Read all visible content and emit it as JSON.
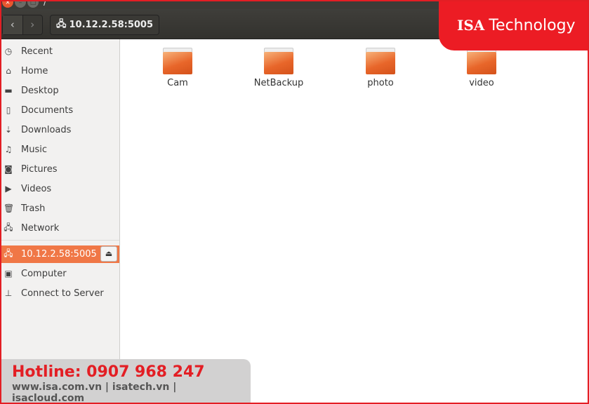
{
  "window": {
    "title": "/"
  },
  "toolbar": {
    "back": "‹",
    "forward": "›",
    "location": "10.12.2.58:5005"
  },
  "sidebar": {
    "items": [
      {
        "label": "Recent",
        "icon": "clock-icon"
      },
      {
        "label": "Home",
        "icon": "home-icon"
      },
      {
        "label": "Desktop",
        "icon": "desktop-folder-icon"
      },
      {
        "label": "Documents",
        "icon": "document-icon"
      },
      {
        "label": "Downloads",
        "icon": "download-icon"
      },
      {
        "label": "Music",
        "icon": "music-icon"
      },
      {
        "label": "Pictures",
        "icon": "camera-icon"
      },
      {
        "label": "Videos",
        "icon": "video-icon"
      },
      {
        "label": "Trash",
        "icon": "trash-icon"
      },
      {
        "label": "Network",
        "icon": "network-icon"
      },
      {
        "label": "10.12.2.58:5005",
        "icon": "network-share-icon"
      },
      {
        "label": "Computer",
        "icon": "computer-icon"
      },
      {
        "label": "Connect to Server",
        "icon": "server-icon"
      }
    ]
  },
  "folders": [
    {
      "name": "Cam"
    },
    {
      "name": "NetBackup"
    },
    {
      "name": "photo"
    },
    {
      "name": "video"
    }
  ],
  "brand": {
    "logo": "ISA Technology",
    "logo_bold": "ISA",
    "logo_rest": "Technology",
    "hotline": "Hotline: 0907 968 247",
    "websites": "www.isa.com.vn | isatech.vn | isacloud.com",
    "accent": "#ec1c24"
  }
}
